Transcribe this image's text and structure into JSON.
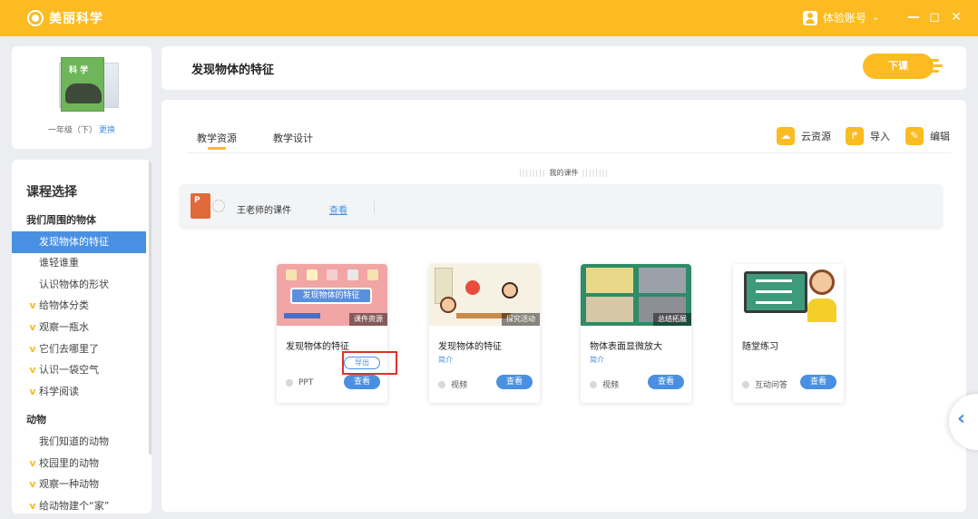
{
  "app": {
    "name": "美丽科学",
    "account": "体验账号",
    "account_suffix": "⌄",
    "minimize": "—",
    "maximize": "◻",
    "close": "✕"
  },
  "book": {
    "cover_title": "科 学",
    "grade": "一年级（下）",
    "change_label": "更换"
  },
  "sidebar": {
    "title": "课程选择",
    "items": [
      {
        "label": "我们周围的物体",
        "kind": "group",
        "marker": ""
      },
      {
        "label": "发现物体的特征",
        "kind": "active",
        "marker": ""
      },
      {
        "label": "谁轻谁重",
        "kind": "item",
        "marker": ""
      },
      {
        "label": "认识物体的形状",
        "kind": "item",
        "marker": ""
      },
      {
        "label": "给物体分类",
        "kind": "item",
        "marker": "v"
      },
      {
        "label": "观察一瓶水",
        "kind": "item",
        "marker": "v"
      },
      {
        "label": "它们去哪里了",
        "kind": "item",
        "marker": "v"
      },
      {
        "label": "认识一袋空气",
        "kind": "item",
        "marker": "v"
      },
      {
        "label": "科学阅读",
        "kind": "item",
        "marker": "v"
      },
      {
        "label": "动物",
        "kind": "group",
        "marker": ""
      },
      {
        "label": "我们知道的动物",
        "kind": "item",
        "marker": ""
      },
      {
        "label": "校园里的动物",
        "kind": "item",
        "marker": "v"
      },
      {
        "label": "观察一种动物",
        "kind": "item",
        "marker": "v"
      },
      {
        "label": "给动物建个“家”",
        "kind": "item",
        "marker": "v"
      }
    ]
  },
  "header": {
    "title": "发现物体的特征",
    "end_label": "下课"
  },
  "tabs": {
    "resources": "教学资源",
    "design": "教学设计"
  },
  "tools": {
    "cloud": "云资源",
    "import": "导入",
    "edit": "编辑"
  },
  "my_courseware": {
    "section_label": "我的课件",
    "name": "王老师的课件",
    "view_label": "查看",
    "icon_letter": "P"
  },
  "cards": [
    {
      "title": "发现物体的特征",
      "subtitle": "",
      "tag": "课件资源",
      "type": "PPT",
      "view": "查看",
      "export": "导出",
      "thumb_text": "发现物体的特征"
    },
    {
      "title": "发现物体的特征",
      "subtitle": "简介",
      "tag": "探究活动",
      "type": "视频",
      "view": "查看"
    },
    {
      "title": "物体表面显微放大",
      "subtitle": "简介",
      "tag": "总结拓展",
      "type": "视频",
      "view": "查看"
    },
    {
      "title": "随堂练习",
      "subtitle": "",
      "tag": "",
      "type": "互动问答",
      "view": "查看"
    }
  ],
  "colors": {
    "accent": "#fbbb21",
    "primary": "#4a90e2",
    "highlight": "#e0302a"
  }
}
